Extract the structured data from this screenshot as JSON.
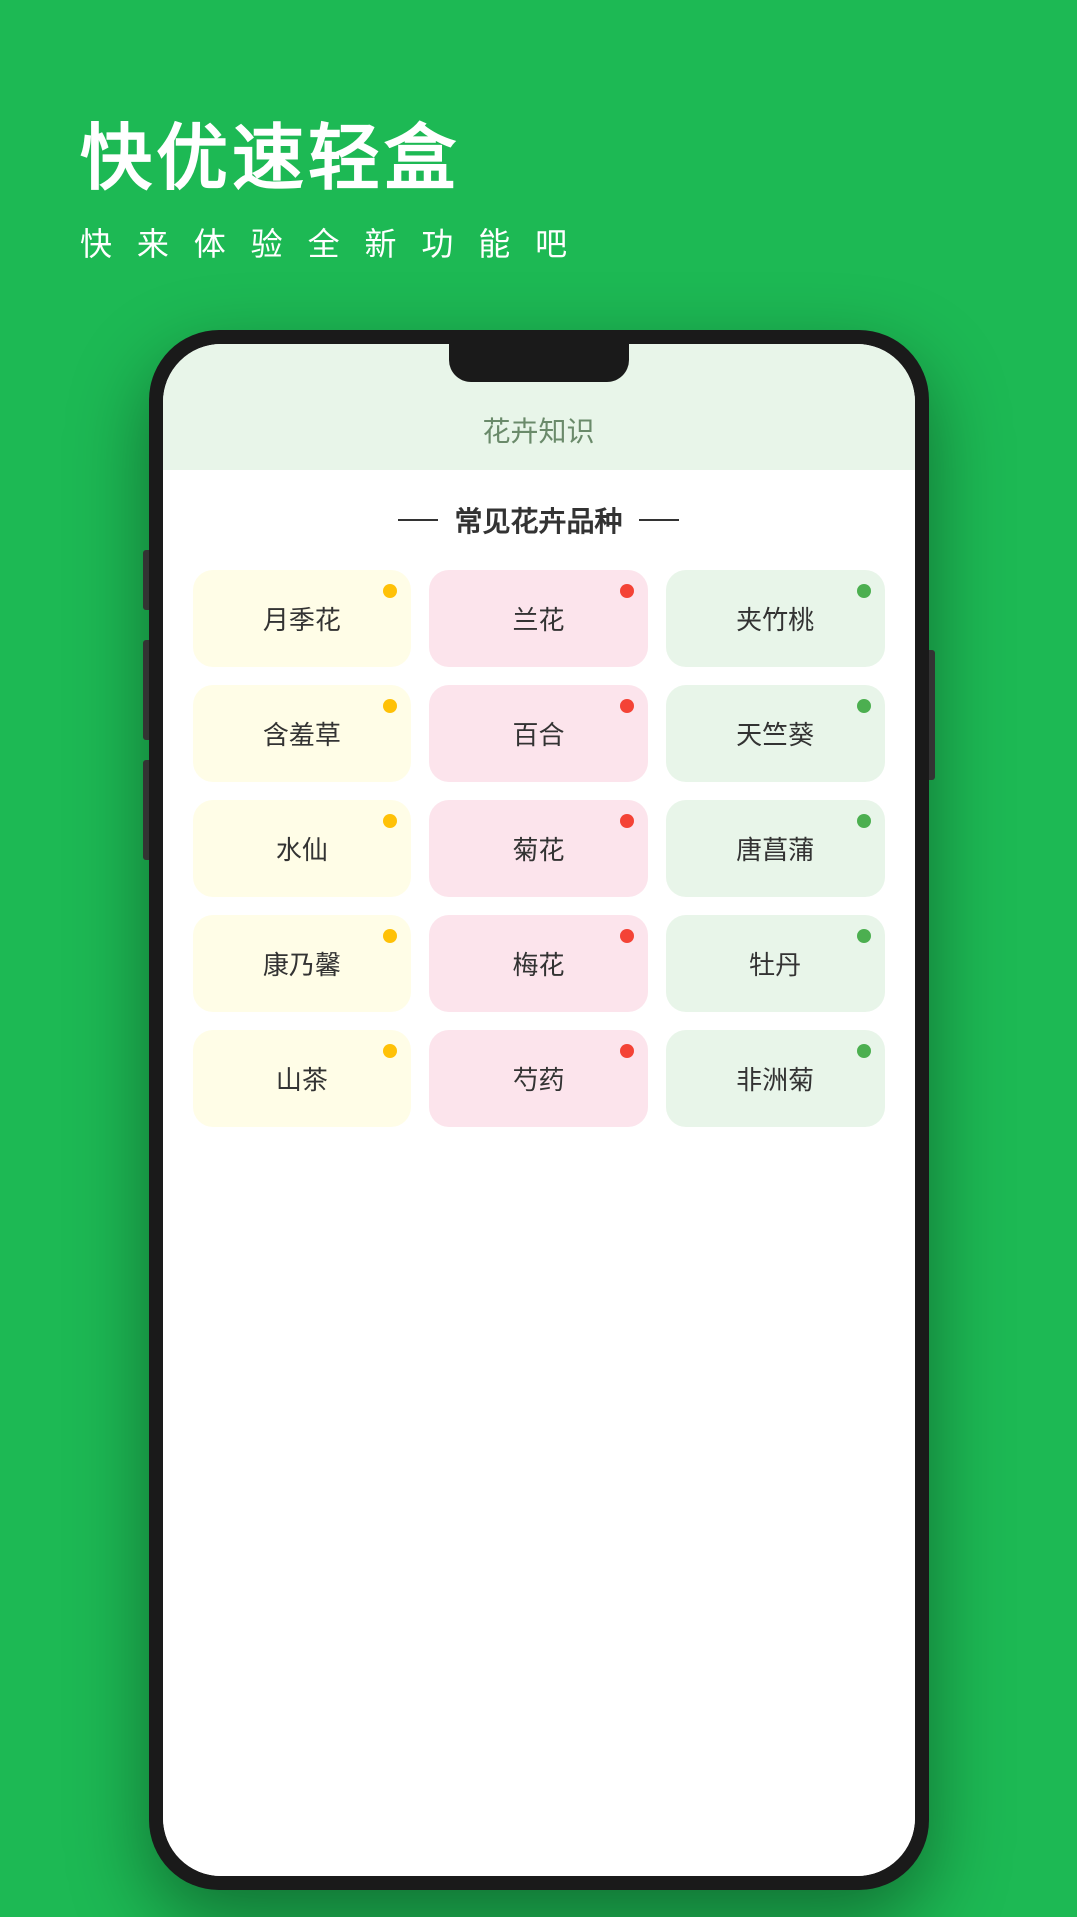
{
  "background": {
    "color": "#1DB954"
  },
  "header": {
    "title": "快优速轻盒",
    "subtitle": "快 来 体 验 全 新 功 能 吧"
  },
  "phone": {
    "screen_title": "花卉知识",
    "section_title": "常见花卉品种",
    "flowers": [
      {
        "name": "月季花",
        "color": "yellow",
        "dot": "yellow"
      },
      {
        "name": "兰花",
        "color": "pink",
        "dot": "red"
      },
      {
        "name": "夹竹桃",
        "color": "green",
        "dot": "green"
      },
      {
        "name": "含羞草",
        "color": "yellow",
        "dot": "yellow"
      },
      {
        "name": "百合",
        "color": "pink",
        "dot": "red"
      },
      {
        "name": "天竺葵",
        "color": "green",
        "dot": "green"
      },
      {
        "name": "水仙",
        "color": "yellow",
        "dot": "yellow"
      },
      {
        "name": "菊花",
        "color": "pink",
        "dot": "red"
      },
      {
        "name": "唐菖蒲",
        "color": "green",
        "dot": "green"
      },
      {
        "name": "康乃馨",
        "color": "yellow",
        "dot": "yellow"
      },
      {
        "name": "梅花",
        "color": "pink",
        "dot": "red"
      },
      {
        "name": "牡丹",
        "color": "green",
        "dot": "green"
      },
      {
        "name": "山茶",
        "color": "yellow",
        "dot": "yellow"
      },
      {
        "name": "芍药",
        "color": "pink",
        "dot": "red"
      },
      {
        "name": "非洲菊",
        "color": "green",
        "dot": "green"
      }
    ]
  }
}
